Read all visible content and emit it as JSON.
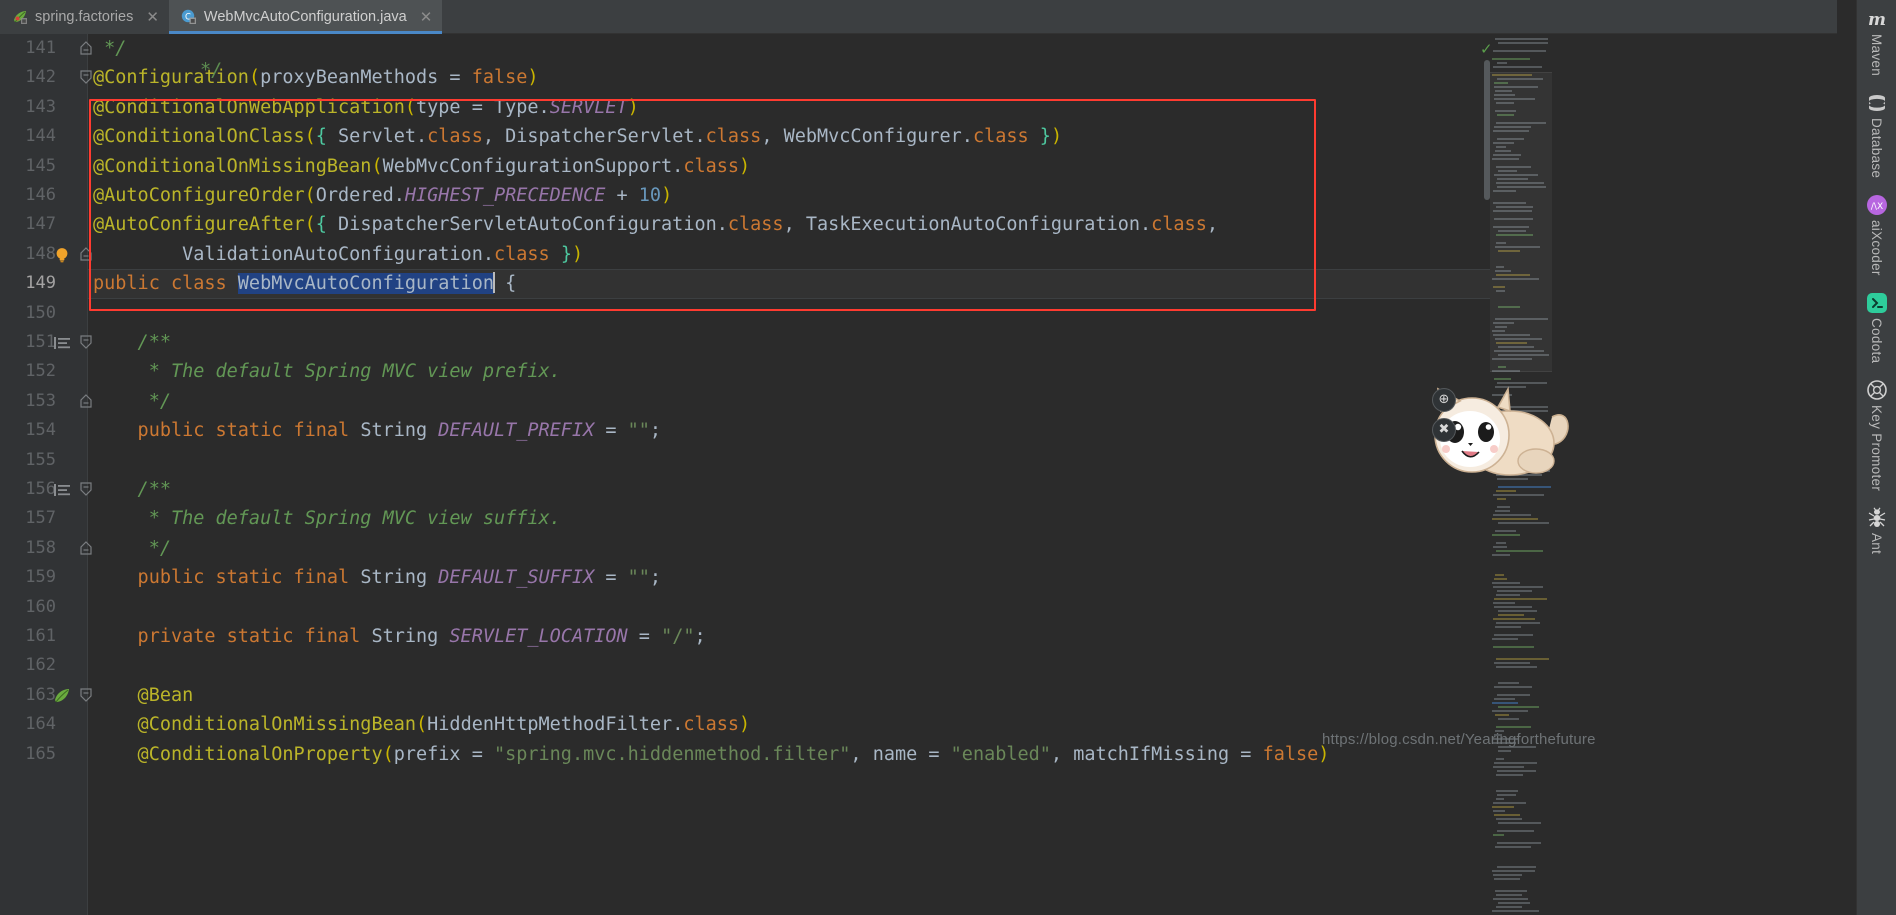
{
  "window": {
    "theme_bg": "#2b2b2b",
    "accent": "#4a88c7",
    "annotation_color": "#ff3b30"
  },
  "tabs": [
    {
      "label": "spring.factories",
      "icon": "spring-leaf-icon",
      "close": "✕",
      "active": false
    },
    {
      "label": "WebMvcAutoConfiguration.java",
      "icon": "java-class-icon",
      "close": "✕",
      "active": true
    }
  ],
  "editor": {
    "current_line": 149,
    "ghost_above": "*/",
    "lines": [
      {
        "n": "141",
        "fold": "end",
        "tokens": [
          {
            "t": " ",
            "c": "t-default"
          },
          {
            "t": "*/",
            "c": "t-cmt"
          }
        ]
      },
      {
        "n": "142",
        "fold": "start",
        "tokens": [
          {
            "t": "@Configuration",
            "c": "t-anno"
          },
          {
            "t": "(",
            "c": "t-paren"
          },
          {
            "t": "proxyBeanMethods",
            "c": "t-default"
          },
          {
            "t": " = ",
            "c": "t-default"
          },
          {
            "t": "false",
            "c": "t-kw"
          },
          {
            "t": ")",
            "c": "t-paren"
          }
        ]
      },
      {
        "n": "143",
        "fold": "",
        "tokens": [
          {
            "t": "@ConditionalOnWebApplication",
            "c": "t-anno"
          },
          {
            "t": "(",
            "c": "t-paren"
          },
          {
            "t": "type",
            "c": "t-default"
          },
          {
            "t": " = ",
            "c": "t-default"
          },
          {
            "t": "Type.",
            "c": "t-default"
          },
          {
            "t": "SERVLET",
            "c": "t-const"
          },
          {
            "t": ")",
            "c": "t-paren"
          }
        ]
      },
      {
        "n": "144",
        "fold": "",
        "tokens": [
          {
            "t": "@ConditionalOnClass",
            "c": "t-anno"
          },
          {
            "t": "(",
            "c": "t-paren"
          },
          {
            "t": "{",
            "c": "t-curly"
          },
          {
            "t": " Servlet.",
            "c": "t-default"
          },
          {
            "t": "class",
            "c": "t-kw"
          },
          {
            "t": ", DispatcherServlet.",
            "c": "t-default"
          },
          {
            "t": "class",
            "c": "t-kw"
          },
          {
            "t": ", WebMvcConfigurer.",
            "c": "t-default"
          },
          {
            "t": "class",
            "c": "t-kw"
          },
          {
            "t": " ",
            "c": "t-default"
          },
          {
            "t": "}",
            "c": "t-curly"
          },
          {
            "t": ")",
            "c": "t-paren"
          }
        ]
      },
      {
        "n": "145",
        "fold": "",
        "tokens": [
          {
            "t": "@ConditionalOnMissingBean",
            "c": "t-anno"
          },
          {
            "t": "(",
            "c": "t-paren"
          },
          {
            "t": "WebMvcConfigurationSupport.",
            "c": "t-default"
          },
          {
            "t": "class",
            "c": "t-kw"
          },
          {
            "t": ")",
            "c": "t-paren"
          }
        ]
      },
      {
        "n": "146",
        "fold": "",
        "tokens": [
          {
            "t": "@AutoConfigureOrder",
            "c": "t-anno"
          },
          {
            "t": "(",
            "c": "t-paren"
          },
          {
            "t": "Ordered.",
            "c": "t-default"
          },
          {
            "t": "HIGHEST_PRECEDENCE",
            "c": "t-const"
          },
          {
            "t": " + ",
            "c": "t-default"
          },
          {
            "t": "10",
            "c": "t-num"
          },
          {
            "t": ")",
            "c": "t-paren"
          }
        ]
      },
      {
        "n": "147",
        "fold": "",
        "tokens": [
          {
            "t": "@AutoConfigureAfter",
            "c": "t-anno"
          },
          {
            "t": "(",
            "c": "t-paren"
          },
          {
            "t": "{",
            "c": "t-curly"
          },
          {
            "t": " DispatcherServletAutoConfiguration.",
            "c": "t-default"
          },
          {
            "t": "class",
            "c": "t-kw"
          },
          {
            "t": ", TaskExecutionAutoConfiguration.",
            "c": "t-default"
          },
          {
            "t": "class",
            "c": "t-kw"
          },
          {
            "t": ",",
            "c": "t-default"
          }
        ]
      },
      {
        "n": "148",
        "fold": "end",
        "icon": "lightbulb-icon",
        "tokens": [
          {
            "t": "        ValidationAutoConfiguration.",
            "c": "t-default"
          },
          {
            "t": "class",
            "c": "t-kw"
          },
          {
            "t": " ",
            "c": "t-default"
          },
          {
            "t": "}",
            "c": "t-curly"
          },
          {
            "t": ")",
            "c": "t-paren"
          }
        ]
      },
      {
        "n": "149",
        "fold": "",
        "current": true,
        "tokens": [
          {
            "t": "public class ",
            "c": "t-kw"
          },
          {
            "t": "WebMvcAutoConfiguration",
            "c": "t-sel"
          },
          {
            "t": "CARET",
            "c": "caret"
          },
          {
            "t": " {",
            "c": "t-default"
          }
        ]
      },
      {
        "n": "150",
        "fold": "",
        "tokens": []
      },
      {
        "n": "151",
        "fold": "start",
        "icon": "doc-lines-icon",
        "tokens": [
          {
            "t": "    /**",
            "c": "t-cmt"
          }
        ]
      },
      {
        "n": "152",
        "fold": "",
        "tokens": [
          {
            "t": "     * The default Spring MVC view prefix.",
            "c": "t-cmt"
          }
        ]
      },
      {
        "n": "153",
        "fold": "end",
        "tokens": [
          {
            "t": "     */",
            "c": "t-cmt"
          }
        ]
      },
      {
        "n": "154",
        "fold": "",
        "tokens": [
          {
            "t": "    public static final ",
            "c": "t-kw"
          },
          {
            "t": "String ",
            "c": "t-default"
          },
          {
            "t": "DEFAULT_PREFIX",
            "c": "t-const"
          },
          {
            "t": " = ",
            "c": "t-default"
          },
          {
            "t": "\"\"",
            "c": "t-str"
          },
          {
            "t": ";",
            "c": "t-default"
          }
        ]
      },
      {
        "n": "155",
        "fold": "",
        "tokens": []
      },
      {
        "n": "156",
        "fold": "start",
        "icon": "doc-lines-icon",
        "tokens": [
          {
            "t": "    /**",
            "c": "t-cmt"
          }
        ]
      },
      {
        "n": "157",
        "fold": "",
        "tokens": [
          {
            "t": "     * The default Spring MVC view suffix.",
            "c": "t-cmt"
          }
        ]
      },
      {
        "n": "158",
        "fold": "end",
        "tokens": [
          {
            "t": "     */",
            "c": "t-cmt"
          }
        ]
      },
      {
        "n": "159",
        "fold": "",
        "tokens": [
          {
            "t": "    public static final ",
            "c": "t-kw"
          },
          {
            "t": "String ",
            "c": "t-default"
          },
          {
            "t": "DEFAULT_SUFFIX",
            "c": "t-const"
          },
          {
            "t": " = ",
            "c": "t-default"
          },
          {
            "t": "\"\"",
            "c": "t-str"
          },
          {
            "t": ";",
            "c": "t-default"
          }
        ]
      },
      {
        "n": "160",
        "fold": "",
        "tokens": []
      },
      {
        "n": "161",
        "fold": "",
        "tokens": [
          {
            "t": "    private static final ",
            "c": "t-kw"
          },
          {
            "t": "String ",
            "c": "t-default"
          },
          {
            "t": "SERVLET_LOCATION",
            "c": "t-const"
          },
          {
            "t": " = ",
            "c": "t-default"
          },
          {
            "t": "\"/\"",
            "c": "t-str"
          },
          {
            "t": ";",
            "c": "t-default"
          }
        ]
      },
      {
        "n": "162",
        "fold": "",
        "tokens": []
      },
      {
        "n": "163",
        "fold": "start",
        "icon": "spring-bean-icon",
        "tokens": [
          {
            "t": "    @Bean",
            "c": "t-anno"
          }
        ]
      },
      {
        "n": "164",
        "fold": "",
        "tokens": [
          {
            "t": "    @ConditionalOnMissingBean",
            "c": "t-anno"
          },
          {
            "t": "(",
            "c": "t-paren"
          },
          {
            "t": "HiddenHttpMethodFilter.",
            "c": "t-default"
          },
          {
            "t": "class",
            "c": "t-kw"
          },
          {
            "t": ")",
            "c": "t-paren"
          }
        ]
      },
      {
        "n": "165",
        "fold": "",
        "clipped": true,
        "tokens": [
          {
            "t": "    @ConditionalOnProperty",
            "c": "t-anno"
          },
          {
            "t": "(",
            "c": "t-paren"
          },
          {
            "t": "prefix",
            "c": "t-default"
          },
          {
            "t": " = ",
            "c": "t-default"
          },
          {
            "t": "\"spring.mvc.hiddenmethod.filter\"",
            "c": "t-str"
          },
          {
            "t": ", ",
            "c": "t-default"
          },
          {
            "t": "name",
            "c": "t-default"
          },
          {
            "t": " = ",
            "c": "t-default"
          },
          {
            "t": "\"enabled\"",
            "c": "t-str"
          },
          {
            "t": ", ",
            "c": "t-default"
          },
          {
            "t": "matchIfMissing",
            "c": "t-default"
          },
          {
            "t": " = ",
            "c": "t-default"
          },
          {
            "t": "false",
            "c": "t-kw"
          },
          {
            "t": ")",
            "c": "t-paren"
          }
        ]
      }
    ]
  },
  "inspection": {
    "status": "ok",
    "check_glyph": "✓"
  },
  "right_sidebar": {
    "items": [
      {
        "label": "Maven",
        "icon": "maven-icon"
      },
      {
        "label": "Database",
        "icon": "database-icon"
      },
      {
        "label": "aiXcoder",
        "icon": "aixcoder-icon"
      },
      {
        "label": "Codota",
        "icon": "codota-icon"
      },
      {
        "label": "Key Promoter",
        "icon": "key-promoter-icon"
      },
      {
        "label": "Ant",
        "icon": "ant-icon"
      }
    ]
  },
  "mascot": {
    "name": "codota-cat-mascot",
    "buttons": [
      {
        "glyph": "⊕",
        "name": "mascot-settings-button"
      },
      {
        "glyph": "✖",
        "name": "mascot-close-button"
      }
    ]
  },
  "watermark": {
    "text": "https://blog.csdn.net/Yearingforthefuture"
  }
}
